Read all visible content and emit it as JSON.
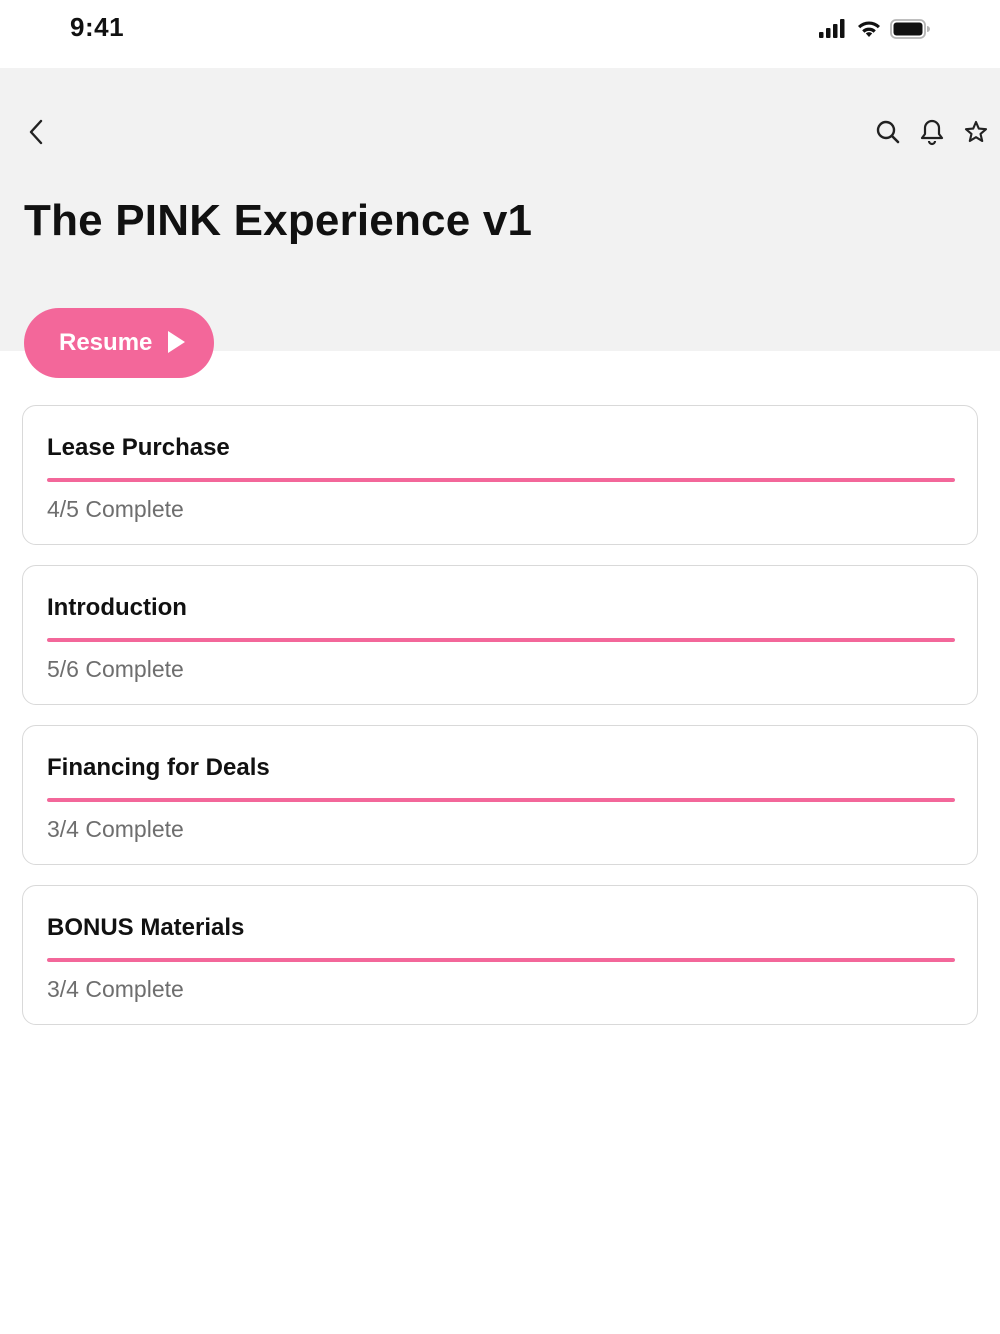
{
  "status_bar": {
    "time": "9:41",
    "icons": [
      "signal-icon",
      "wifi-icon",
      "battery-icon"
    ]
  },
  "header": {
    "back_icon": "chevron-left-icon",
    "actions": [
      "search-icon",
      "bell-icon",
      "star-icon"
    ],
    "title": "The PINK Experience v1"
  },
  "resume": {
    "label": "Resume",
    "icon": "play-icon"
  },
  "colors": {
    "accent": "#f3679a",
    "header_bg": "#f2f2f2",
    "muted_text": "#6e6e6e"
  },
  "modules": [
    {
      "title": "Lease Purchase",
      "status": "4/5 Complete",
      "progress": 1.0
    },
    {
      "title": "Introduction",
      "status": "5/6 Complete",
      "progress": 1.0
    },
    {
      "title": "Financing for Deals",
      "status": "3/4 Complete",
      "progress": 1.0
    },
    {
      "title": "BONUS Materials",
      "status": "3/4 Complete",
      "progress": 1.0
    }
  ]
}
